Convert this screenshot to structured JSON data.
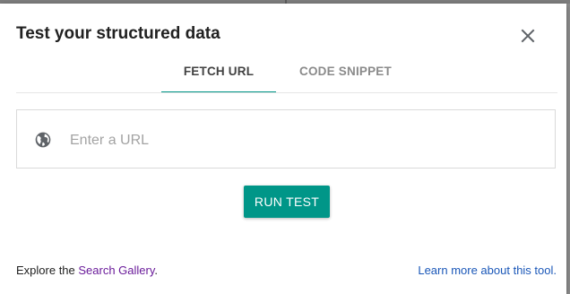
{
  "dialog": {
    "title": "Test your structured data",
    "close_icon": "close-icon"
  },
  "tabs": [
    {
      "label": "FETCH URL",
      "active": true
    },
    {
      "label": "CODE SNIPPET",
      "active": false
    }
  ],
  "url_field": {
    "placeholder": "Enter a URL",
    "value": "",
    "icon": "globe-icon"
  },
  "run_button": {
    "label": "RUN TEST"
  },
  "footer": {
    "explore_prefix": "Explore the ",
    "gallery_link": "Search Gallery",
    "explore_suffix": ".",
    "learn_more": "Learn more about this tool."
  },
  "colors": {
    "accent": "#009688",
    "link_visited": "#6a1b9a",
    "link": "#1a57b8"
  }
}
